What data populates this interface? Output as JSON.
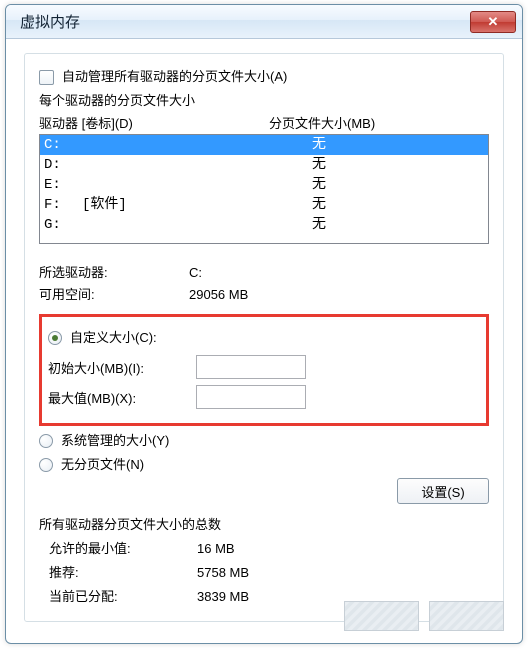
{
  "window_title": "虚拟内存",
  "auto_manage_label": "自动管理所有驱动器的分页文件大小(A)",
  "per_drive_label": "每个驱动器的分页文件大小",
  "col_drive_label": "驱动器 [卷标](D)",
  "col_size_label": "分页文件大小(MB)",
  "drives": [
    {
      "letter": "C:",
      "label": "",
      "size": "无",
      "selected": true
    },
    {
      "letter": "D:",
      "label": "",
      "size": "无",
      "selected": false
    },
    {
      "letter": "E:",
      "label": "",
      "size": "无",
      "selected": false
    },
    {
      "letter": "F:",
      "label": "[软件]",
      "size": "无",
      "selected": false
    },
    {
      "letter": "G:",
      "label": "",
      "size": "无",
      "selected": false
    }
  ],
  "selected_drive_label": "所选驱动器:",
  "selected_drive_value": "C:",
  "avail_space_label": "可用空间:",
  "avail_space_value": "29056 MB",
  "custom_label": "自定义大小(C):",
  "init_size_label": "初始大小(MB)(I):",
  "init_size_value": "",
  "max_size_label": "最大值(MB)(X):",
  "max_size_value": "",
  "system_managed_label": "系统管理的大小(Y)",
  "no_paging_label": "无分页文件(N)",
  "set_button_label": "设置(S)",
  "total_heading": "所有驱动器分页文件大小的总数",
  "min_allowed_label": "允许的最小值:",
  "min_allowed_value": "16 MB",
  "recommended_label": "推荐:",
  "recommended_value": "5758 MB",
  "current_label": "当前已分配:",
  "current_value": "3839 MB"
}
